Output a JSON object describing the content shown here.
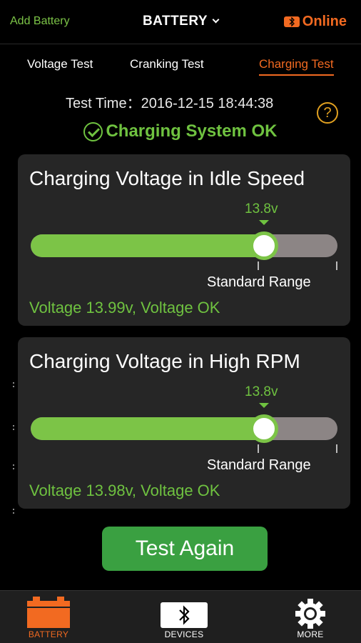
{
  "header": {
    "add_battery": "Add Battery",
    "title": "BATTERY",
    "online": "Online"
  },
  "tabs": [
    {
      "label": "Voltage Test",
      "active": false
    },
    {
      "label": "Cranking Test",
      "active": false
    },
    {
      "label": "Charging Test",
      "active": true
    }
  ],
  "test_time": "Test Time：2016-12-15 18:44:38",
  "help": "?",
  "status": "Charging System OK",
  "cards": [
    {
      "title": "Charging Voltage in Idle Speed",
      "marker_value": "13.8v",
      "fill_fraction": 0.76,
      "range_label": "Standard Range",
      "result": "Voltage 13.99v, Voltage OK"
    },
    {
      "title": "Charging Voltage in High RPM",
      "marker_value": "13.8v",
      "fill_fraction": 0.76,
      "range_label": "Standard Range",
      "result": "Voltage 13.98v, Voltage OK"
    }
  ],
  "test_again": "Test Again",
  "nav": [
    {
      "label": "BATTERY",
      "icon": "battery-icon",
      "active": true
    },
    {
      "label": "DEVICES",
      "icon": "bluetooth-icon",
      "active": false
    },
    {
      "label": "MORE",
      "icon": "gear-icon",
      "active": false
    }
  ],
  "colors": {
    "accent": "#f26a21",
    "ok_green": "#6fc240",
    "bar_green": "#7cc447",
    "button_green": "#3aa041",
    "help_yellow": "#e0a020",
    "card_bg": "#262626"
  }
}
